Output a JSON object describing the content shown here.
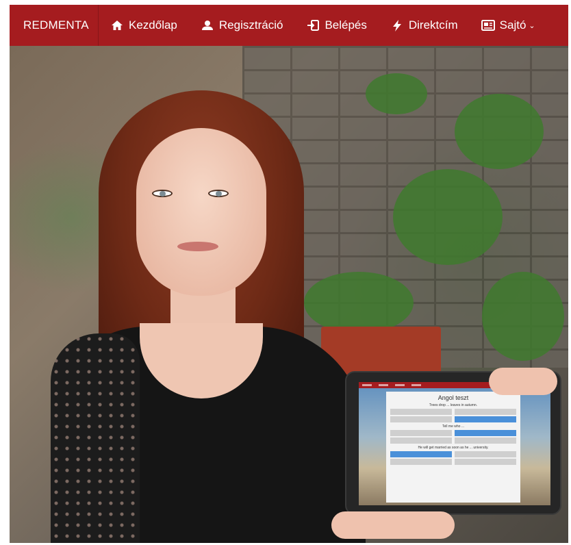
{
  "navbar": {
    "brand": "REDMENTA",
    "items": [
      {
        "label": "Kezdőlap",
        "icon": "home-icon"
      },
      {
        "label": "Regisztráció",
        "icon": "user-icon"
      },
      {
        "label": "Belépés",
        "icon": "sign-in-icon"
      },
      {
        "label": "Direktcím",
        "icon": "bolt-icon"
      },
      {
        "label": "Sajtó",
        "icon": "newspaper-icon",
        "dropdown": true
      }
    ],
    "caret": "⌄"
  },
  "colors": {
    "accent": "#a51c1f",
    "selected_option": "#4a90d9"
  },
  "tablet": {
    "quiz_title": "Angol teszt",
    "questions": [
      {
        "text": "Trees drop ... leaves in autumn.",
        "options": [
          "",
          "",
          "",
          ""
        ],
        "selected": 3
      },
      {
        "text": "Tell me who ...",
        "options": [
          "",
          "",
          "",
          ""
        ],
        "selected": 1
      },
      {
        "text": "He will get married as soon as he ... university.",
        "options": [
          "",
          "",
          "",
          ""
        ],
        "selected": 0
      }
    ]
  }
}
